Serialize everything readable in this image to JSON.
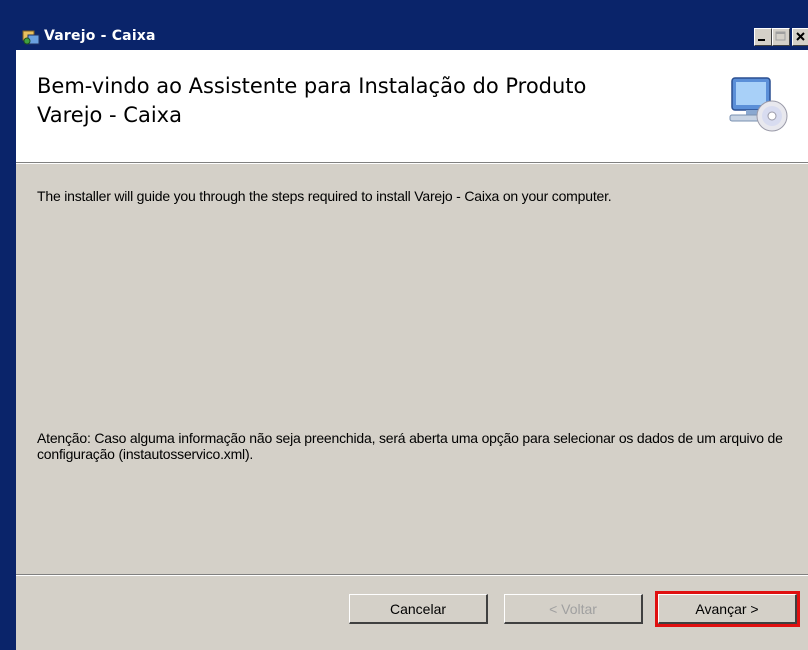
{
  "window": {
    "title": "Varejo - Caixa"
  },
  "header": {
    "title": "Bem-vindo ao Assistente para Instalação do Produto Varejo - Caixa",
    "icon": "computer-cd-icon"
  },
  "body": {
    "intro": "The installer will guide you through the steps required to install Varejo - Caixa on your computer.",
    "notice": "Atenção: Caso alguma informação não seja preenchida, será aberta uma opção para selecionar os dados de um arquivo de configuração (instautosservico.xml)."
  },
  "buttons": {
    "cancel": "Cancelar",
    "back": "< Voltar",
    "next": "Avançar >"
  },
  "colors": {
    "titlebar": "#0a246a",
    "dialog": "#d4d0c8",
    "highlight": "#e01010"
  }
}
